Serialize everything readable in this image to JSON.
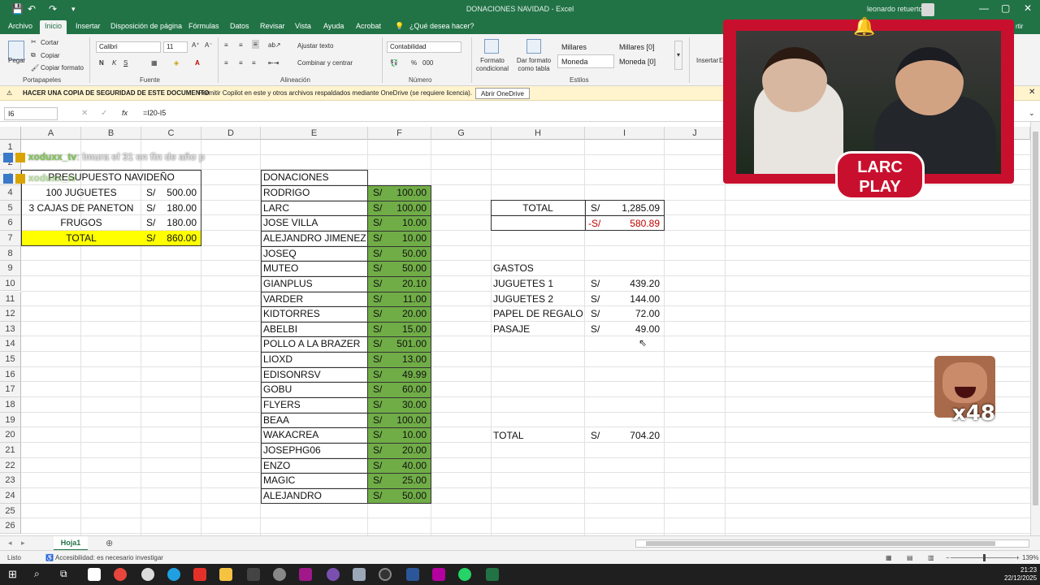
{
  "window": {
    "title": "DONACIONES NAVIDAD - Excel",
    "user": "leonardo retuerto",
    "minimize": "—",
    "maximize": "▢",
    "close": "✕"
  },
  "quick_access": {
    "save": "💾",
    "undo": "↶",
    "redo": "↷",
    "more": "▾"
  },
  "ribbon_tabs": [
    "Archivo",
    "Inicio",
    "Insertar",
    "Disposición de página",
    "Fórmulas",
    "Datos",
    "Revisar",
    "Vista",
    "Ayuda",
    "Acrobat",
    "¿Qué desea hacer?"
  ],
  "ribbon": {
    "paste": "Pegar",
    "cut": "Cortar",
    "copy": "Copiar",
    "format_painter": "Copiar formato",
    "group_clipboard": "Portapapeles",
    "font_name": "Calibri",
    "font_size": "11",
    "bold": "N",
    "italic": "K",
    "underline": "S",
    "group_font": "Fuente",
    "wrap_text": "Ajustar texto",
    "merge_center": "Combinar y centrar",
    "group_alignment": "Alineación",
    "number_format": "Contabilidad",
    "percent": "%",
    "thousands": "000",
    "group_number": "Número",
    "conditional_format": "Formato condicional",
    "format_as_table": "Dar formato como tabla",
    "styles": [
      "Millares",
      "Millares [0]",
      "Moneda",
      "Moneda [0]"
    ],
    "group_styles": "Estilos",
    "insert": "Insertar",
    "delete_partial": "Eli",
    "partial_label": "C",
    "partial_label2": "rtir"
  },
  "message_bar": {
    "title": "HACER UNA COPIA DE SEGURIDAD DE ESTE DOCUMENTO",
    "text": "Permitir Copilot en este y otros archivos respaldados mediante OneDrive (se requiere licencia).",
    "button": "Abrir OneDrive"
  },
  "formula_bar": {
    "name_box": "I6",
    "fx": "fx",
    "formula": "=I20-I5"
  },
  "columns": [
    "A",
    "B",
    "C",
    "D",
    "E",
    "F",
    "G",
    "H",
    "I",
    "J"
  ],
  "rows": [
    "1",
    "2",
    "3",
    "4",
    "5",
    "6",
    "7",
    "8",
    "9",
    "10",
    "11",
    "12",
    "13",
    "14",
    "15",
    "16",
    "17",
    "18",
    "19",
    "20",
    "21",
    "22",
    "23",
    "24",
    "25",
    "26"
  ],
  "budget": {
    "header": "PRESUPUESTO NAVIDEÑO",
    "items": [
      {
        "label": "100 JUGUETES",
        "cur": "S/",
        "amount": "500.00"
      },
      {
        "label": "3 CAJAS DE PANETON",
        "cur": "S/",
        "amount": "180.00"
      },
      {
        "label": "FRUGOS",
        "cur": "S/",
        "amount": "180.00"
      }
    ],
    "total_label": "TOTAL",
    "total_cur": "S/",
    "total_amount": "860.00"
  },
  "donations": {
    "header": "DONACIONES",
    "rows": [
      {
        "name": "RODRIGO",
        "cur": "S/",
        "amount": "100.00"
      },
      {
        "name": "LARC",
        "cur": "S/",
        "amount": "100.00"
      },
      {
        "name": "JOSE VILLA",
        "cur": "S/",
        "amount": "10.00"
      },
      {
        "name": "ALEJANDRO JIMENEZ",
        "cur": "S/",
        "amount": "10.00"
      },
      {
        "name": "JOSEQ",
        "cur": "S/",
        "amount": "50.00"
      },
      {
        "name": "MUTEO",
        "cur": "S/",
        "amount": "50.00"
      },
      {
        "name": "GIANPLUS",
        "cur": "S/",
        "amount": "20.10"
      },
      {
        "name": "VARDER",
        "cur": "S/",
        "amount": "11.00"
      },
      {
        "name": "KIDTORRES",
        "cur": "S/",
        "amount": "20.00"
      },
      {
        "name": "ABELBI",
        "cur": "S/",
        "amount": "15.00"
      },
      {
        "name": "POLLO A LA BRAZER",
        "cur": "S/",
        "amount": "501.00"
      },
      {
        "name": "LIOXD",
        "cur": "S/",
        "amount": "13.00"
      },
      {
        "name": "EDISONRSV",
        "cur": "S/",
        "amount": "49.99"
      },
      {
        "name": "GOBU",
        "cur": "S/",
        "amount": "60.00"
      },
      {
        "name": "FLYERS",
        "cur": "S/",
        "amount": "30.00"
      },
      {
        "name": "BEAA",
        "cur": "S/",
        "amount": "100.00"
      },
      {
        "name": "WAKACREA",
        "cur": "S/",
        "amount": "10.00"
      },
      {
        "name": "JOSEPHG06",
        "cur": "S/",
        "amount": "20.00"
      },
      {
        "name": "ENZO",
        "cur": "S/",
        "amount": "40.00"
      },
      {
        "name": "MAGIC",
        "cur": "S/",
        "amount": "25.00"
      },
      {
        "name": "ALEJANDRO",
        "cur": "S/",
        "amount": "50.00"
      }
    ]
  },
  "summary": {
    "total_label": "TOTAL",
    "total_cur": "S/",
    "total_amount": "1,285.09",
    "diff_cur": "-S/",
    "diff_amount": "580.89"
  },
  "expenses": {
    "header": "GASTOS",
    "rows": [
      {
        "label": "JUGUETES 1",
        "cur": "S/",
        "amount": "439.20"
      },
      {
        "label": "JUGUETES 2",
        "cur": "S/",
        "amount": "144.00"
      },
      {
        "label": "PAPEL DE REGALO",
        "cur": "S/",
        "amount": "72.00"
      },
      {
        "label": "PASAJE",
        "cur": "S/",
        "amount": "49.00"
      }
    ],
    "total_label": "TOTAL",
    "total_cur": "S/",
    "total_amount": "704.20"
  },
  "chat": [
    {
      "nick": "xoduxx_tv",
      "msg": ": lmura el 31 en fin de año p"
    },
    {
      "nick": "xoduxx_tv",
      "msg": ""
    }
  ],
  "stream": {
    "logo_line1": "LARC",
    "logo_line2": "PLAY",
    "emote_count": "x48"
  },
  "sheet_tab": "Hoja1",
  "add_sheet": "⊕",
  "status": {
    "ready": "Listo",
    "accessibility": "Accesibilidad: es necesario investigar",
    "zoom": "139%"
  },
  "clock": {
    "time": "21:23",
    "date": "22/12/2025"
  },
  "colors": {
    "excel_green": "#217346",
    "budget_total_fill": "#ffff00",
    "donation_fill": "#70ad47",
    "negative": "#c00000"
  }
}
